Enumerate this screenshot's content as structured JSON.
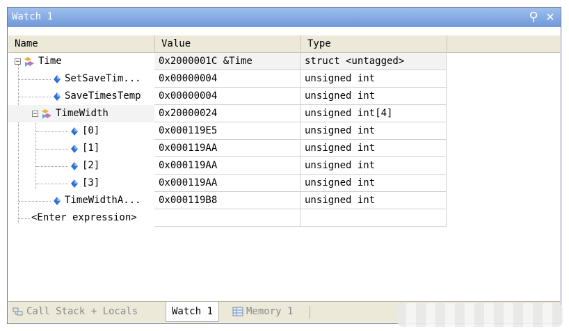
{
  "window": {
    "title": "Watch 1"
  },
  "columns": {
    "name": "Name",
    "value": "Value",
    "type": "Type"
  },
  "rows": [
    {
      "name": "Time",
      "value": "0x2000001C &Time",
      "type": "struct <untagged>",
      "icon": "struct-icon",
      "expander": "minus"
    },
    {
      "name": "SetSaveTim...",
      "value": "0x00000004",
      "type": "unsigned int",
      "icon": "variable-icon"
    },
    {
      "name": "SaveTimesTemp",
      "value": "0x00000004",
      "type": "unsigned int",
      "icon": "variable-icon"
    },
    {
      "name": "TimeWidth",
      "value": "0x20000024",
      "type": "unsigned int[4]",
      "icon": "struct-icon",
      "expander": "minus"
    },
    {
      "name": "[0]",
      "value": "0x000119E5",
      "type": "unsigned int",
      "icon": "variable-icon"
    },
    {
      "name": "[1]",
      "value": "0x000119AA",
      "type": "unsigned int",
      "icon": "variable-icon"
    },
    {
      "name": "[2]",
      "value": "0x000119AA",
      "type": "unsigned int",
      "icon": "variable-icon"
    },
    {
      "name": "[3]",
      "value": "0x000119AA",
      "type": "unsigned int",
      "icon": "variable-icon"
    },
    {
      "name": "TimeWidthA...",
      "value": "0x000119B8",
      "type": "unsigned int",
      "icon": "variable-icon"
    },
    {
      "name": "<Enter expression>",
      "value": "",
      "type": ""
    }
  ],
  "tabs": [
    {
      "label": "Call Stack + Locals",
      "icon": "call-stack-icon",
      "active": false
    },
    {
      "label": "Watch 1",
      "active": true
    },
    {
      "label": "Memory 1",
      "icon": "memory-icon",
      "active": false
    }
  ],
  "colors": {
    "titlebar": "#7fa5e0",
    "variable_icon": "#2f6fd6",
    "struct_icon": "#e2b437"
  }
}
